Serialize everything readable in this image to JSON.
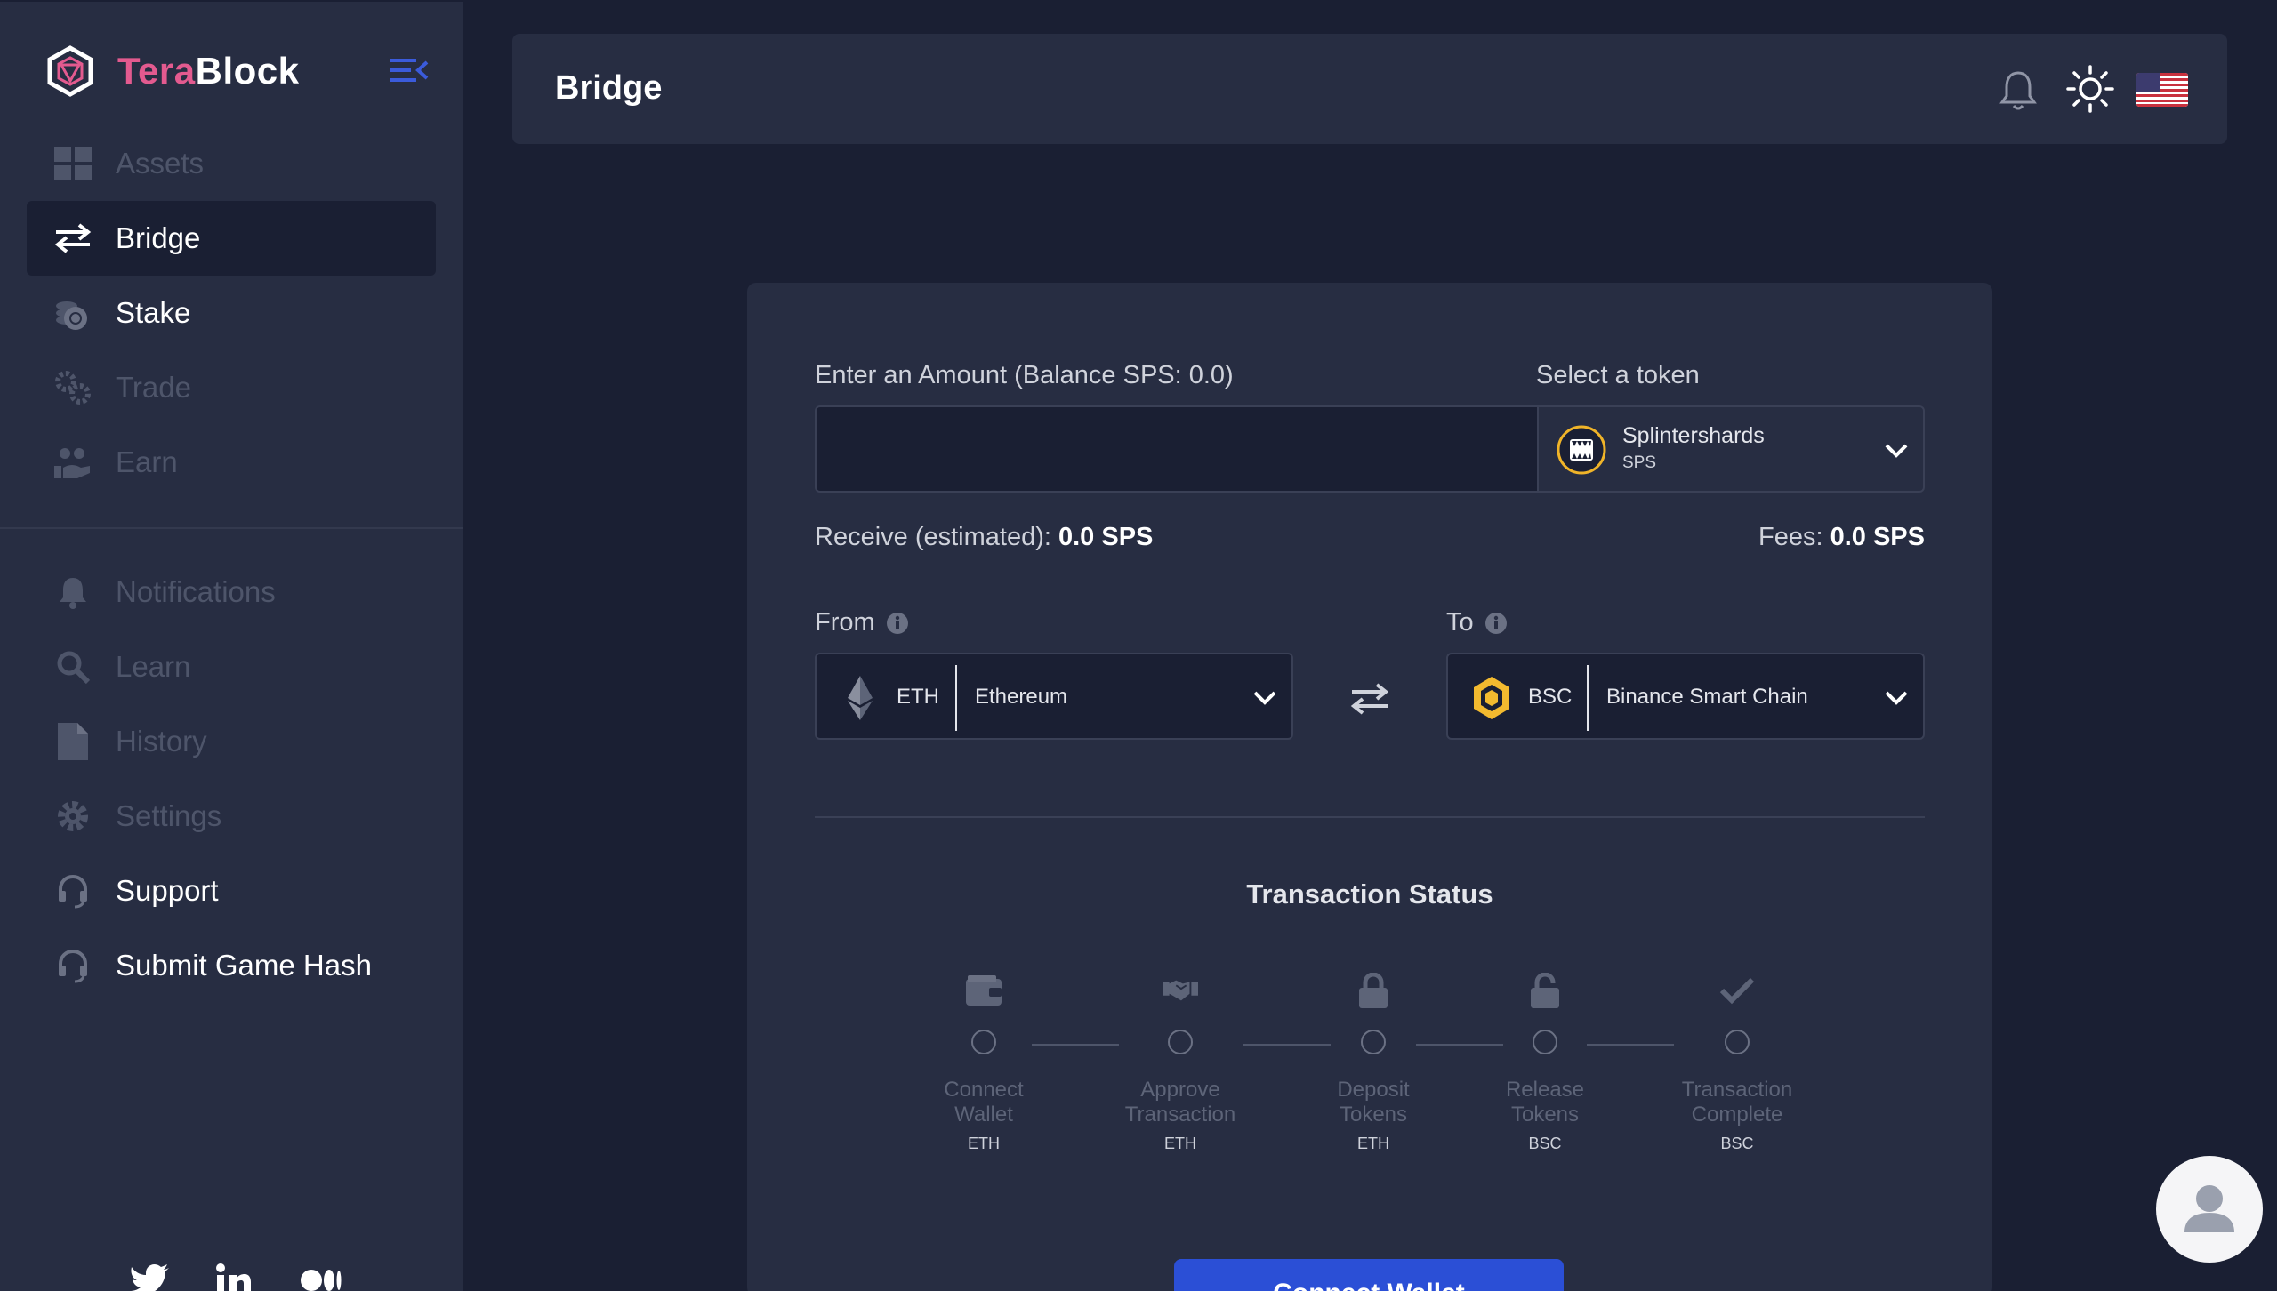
{
  "brand": {
    "name_part1": "Tera",
    "name_part2": "Block"
  },
  "sidebar": {
    "items": [
      {
        "label": "Assets",
        "icon": "grid-icon"
      },
      {
        "label": "Bridge",
        "icon": "arrows-swap-icon"
      },
      {
        "label": "Stake",
        "icon": "coins-stack-icon"
      },
      {
        "label": "Trade",
        "icon": "gears-icon"
      },
      {
        "label": "Earn",
        "icon": "hand-coins-icon"
      },
      {
        "label": "Notifications",
        "icon": "bell-icon"
      },
      {
        "label": "Learn",
        "icon": "search-icon"
      },
      {
        "label": "History",
        "icon": "document-icon"
      },
      {
        "label": "Settings",
        "icon": "gear-icon"
      },
      {
        "label": "Support",
        "icon": "headset-icon"
      },
      {
        "label": "Submit Game Hash",
        "icon": "headset-icon"
      }
    ],
    "social": [
      "twitter-icon",
      "linkedin-icon",
      "medium-icon"
    ]
  },
  "header": {
    "title": "Bridge"
  },
  "form": {
    "amount_label": "Enter an Amount (Balance SPS: 0.0)",
    "amount_value": "",
    "token_label": "Select a token",
    "token_name": "Splintershards",
    "token_symbol": "SPS",
    "receive_label": "Receive (estimated):",
    "receive_value": "0.0 SPS",
    "fees_label": "Fees:",
    "fees_value": "0.0 SPS",
    "from_label": "From",
    "to_label": "To",
    "from_chain_symbol": "ETH",
    "from_chain_name": "Ethereum",
    "to_chain_symbol": "BSC",
    "to_chain_name": "Binance Smart Chain"
  },
  "status": {
    "title": "Transaction Status",
    "steps": [
      {
        "line1": "Connect",
        "line2": "Wallet",
        "chain": "ETH",
        "icon": "wallet-icon"
      },
      {
        "line1": "Approve",
        "line2": "Transaction",
        "chain": "ETH",
        "icon": "handshake-icon"
      },
      {
        "line1": "Deposit",
        "line2": "Tokens",
        "chain": "ETH",
        "icon": "lock-icon"
      },
      {
        "line1": "Release",
        "line2": "Tokens",
        "chain": "BSC",
        "icon": "unlock-icon"
      },
      {
        "line1": "Transaction",
        "line2": "Complete",
        "chain": "BSC",
        "icon": "check-icon"
      }
    ]
  },
  "connect_button": "Connect Wallet",
  "colors": {
    "accent": "#2b4fd6",
    "brand_pink": "#e35a8f",
    "bg": "#1a1f33",
    "panel": "#272d42"
  }
}
